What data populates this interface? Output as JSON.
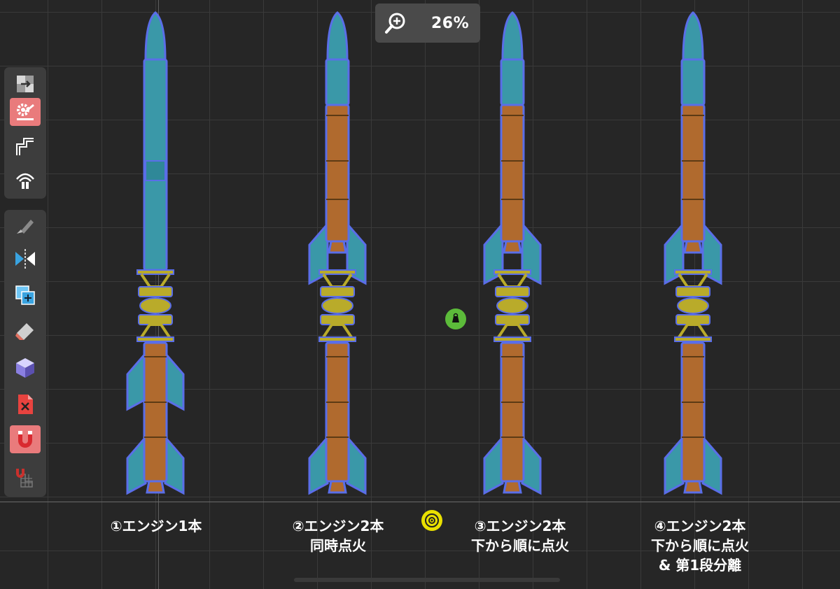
{
  "zoom": {
    "value": "26%",
    "icon": "zoom-in-icon"
  },
  "toolbar_top": [
    {
      "name": "part-move-tool",
      "icon": "move-icon"
    },
    {
      "name": "build-settings-tool",
      "icon": "gear-brush-icon",
      "active": true
    },
    {
      "name": "pipe-tool",
      "icon": "pipe-icon"
    },
    {
      "name": "symmetry-radial-tool",
      "icon": "antenna-icon"
    }
  ],
  "toolbar_bottom": [
    {
      "name": "paint-tool",
      "icon": "paint-brush-icon"
    },
    {
      "name": "mirror-tool",
      "icon": "mirror-icon"
    },
    {
      "name": "clone-tool",
      "icon": "clone-icon"
    },
    {
      "name": "eraser-tool",
      "icon": "eraser-icon"
    },
    {
      "name": "cube-tool",
      "icon": "cube-icon"
    },
    {
      "name": "delete-tool",
      "icon": "delete-file-icon"
    },
    {
      "name": "magnet-tool",
      "icon": "magnet-icon",
      "active": true
    },
    {
      "name": "grid-snap-tool",
      "icon": "grid-magnet-icon"
    }
  ],
  "captions": [
    {
      "text": "①エンジン1本"
    },
    {
      "text": "②エンジン2本\n同時点火"
    },
    {
      "text": "③エンジン2本\n下から順に点火"
    },
    {
      "text": "④エンジン2本\n下から順に点火\n& 第1段分離"
    }
  ],
  "colors": {
    "background": "#262626",
    "grid": "#3a3a3a",
    "fuel_tank_blue": "#3a98a8",
    "fuel_tank_orange": "#b06a2e",
    "decoupler_yellow": "#b9ab2a",
    "selection_outline": "#5a6ee8",
    "center_of_mass": "#e9e000",
    "center_of_thrust": "#5cbb3a",
    "active_tool": "#e97b7c"
  }
}
